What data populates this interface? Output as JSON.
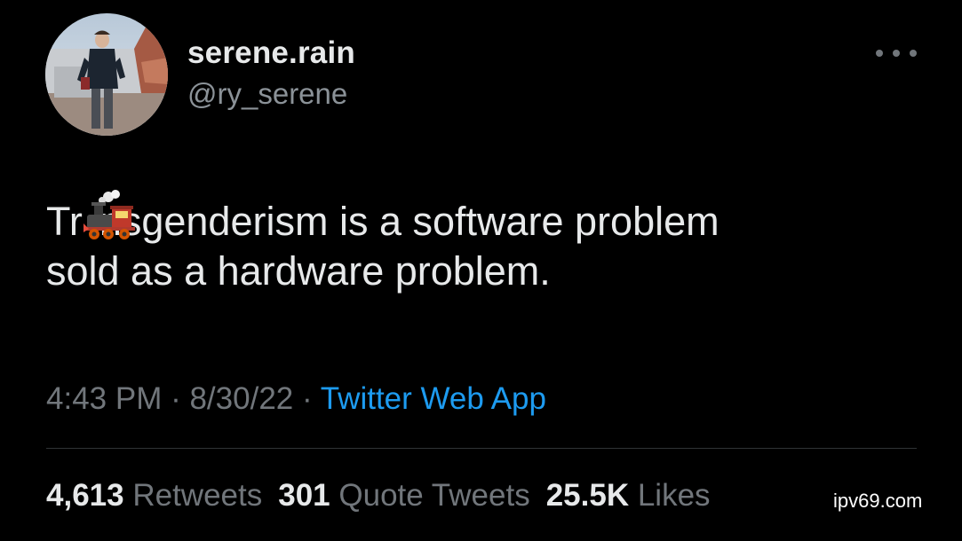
{
  "author": {
    "display_name": "serene.rain",
    "handle": "@ry_serene"
  },
  "more_icon": "more-horizontal-icon",
  "tweet": {
    "text_line1_before_emoji": "Tr",
    "emoji": "steam-locomotive-emoji",
    "text_line1_after_emoji": "nsgenderism is a software problem",
    "text_line2": "sold as a hardware problem."
  },
  "meta": {
    "time": "4:43 PM",
    "sep1": " · ",
    "date": "8/30/22",
    "sep2": " · ",
    "source": "Twitter Web App"
  },
  "stats": {
    "retweets_count": "4,613",
    "retweets_label": "Retweets",
    "quotes_count": "301",
    "quotes_label": "Quote Tweets",
    "likes_count": "25.5K",
    "likes_label": "Likes"
  },
  "watermark": "ipv69.com",
  "colors": {
    "background": "#000000",
    "primary_text": "#e7e9ea",
    "secondary_text": "#71767b",
    "link": "#1d9bf0",
    "divider": "#2f3336"
  }
}
